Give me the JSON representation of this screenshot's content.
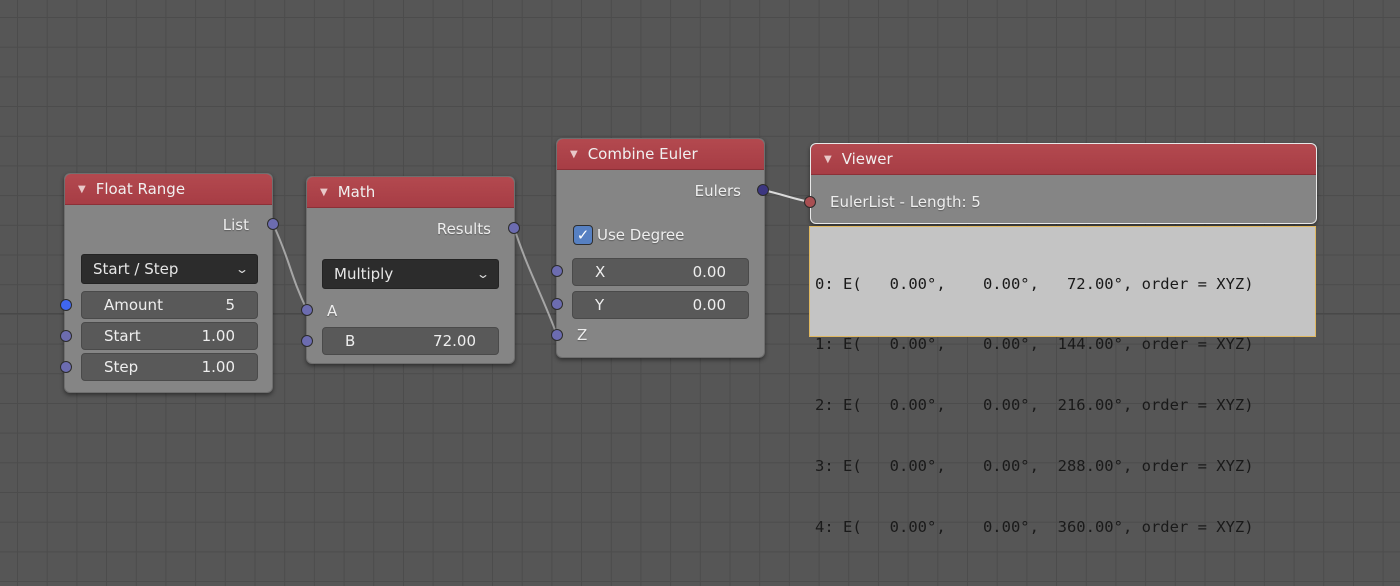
{
  "nodes": {
    "float_range": {
      "title": "Float Range",
      "output_label": "List",
      "mode_dropdown": "Start / Step",
      "fields": [
        {
          "label": "Amount",
          "value": "5"
        },
        {
          "label": "Start",
          "value": "1.00"
        },
        {
          "label": "Step",
          "value": "1.00"
        }
      ]
    },
    "math": {
      "title": "Math",
      "output_label": "Results",
      "operation_dropdown": "Multiply",
      "input_a_label": "A",
      "input_b": {
        "label": "B",
        "value": "72.00"
      }
    },
    "combine_euler": {
      "title": "Combine Euler",
      "output_label": "Eulers",
      "use_degree_label": "Use Degree",
      "use_degree_checked": true,
      "fields": [
        {
          "label": "X",
          "value": "0.00"
        },
        {
          "label": "Y",
          "value": "0.00"
        }
      ],
      "input_z_label": "Z"
    },
    "viewer": {
      "title": "Viewer",
      "input_label": "EulerList - Length: 5",
      "output_lines": [
        "0: E(   0.00°,    0.00°,   72.00°, order = XYZ)",
        "1: E(   0.00°,    0.00°,  144.00°, order = XYZ)",
        "2: E(   0.00°,    0.00°,  216.00°, order = XYZ)",
        "3: E(   0.00°,    0.00°,  288.00°, order = XYZ)",
        "4: E(   0.00°,    0.00°,  360.00°, order = XYZ)"
      ]
    }
  },
  "icons": {
    "collapse": "▼",
    "dropdown": "⌄",
    "check": "✓"
  },
  "colors": {
    "header": "#a73d45",
    "node_body": "#858585",
    "socket_float": "#6c6cb0",
    "socket_int": "#3f66f0",
    "socket_euler": "#3c3680",
    "socket_generic": "#a84f52",
    "viewer_border": "#e0b860"
  }
}
